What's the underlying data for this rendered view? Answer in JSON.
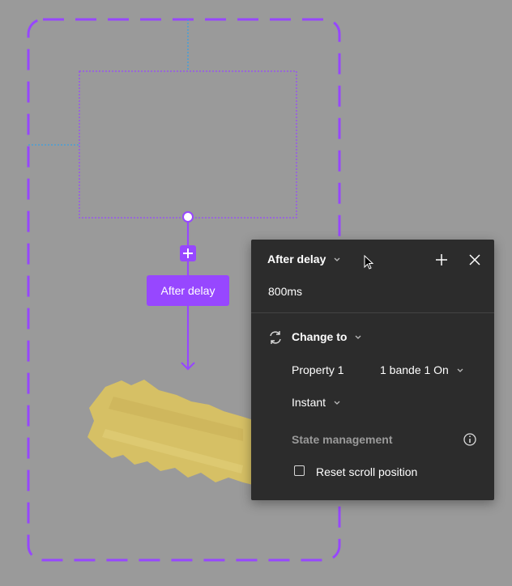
{
  "flow": {
    "tag_label": "After delay"
  },
  "panel": {
    "trigger_label": "After delay",
    "delay_value": "800ms",
    "action_label": "Change to",
    "property_label": "Property 1",
    "property_value": "1 bande 1 On",
    "animation_label": "Instant",
    "state_section_label": "State management",
    "reset_scroll_label": "Reset scroll position",
    "reset_scroll_checked": false
  },
  "icons": [
    "chevron-down-icon",
    "plus-icon",
    "close-icon",
    "swap-icon",
    "info-icon",
    "cursor-icon"
  ],
  "colors": {
    "canvas_bg": "#9a9a9a",
    "accent": "#9747ff",
    "guide": "#3b9fe0",
    "panel_bg": "#2c2c2c",
    "tape": "#d9c36a"
  }
}
